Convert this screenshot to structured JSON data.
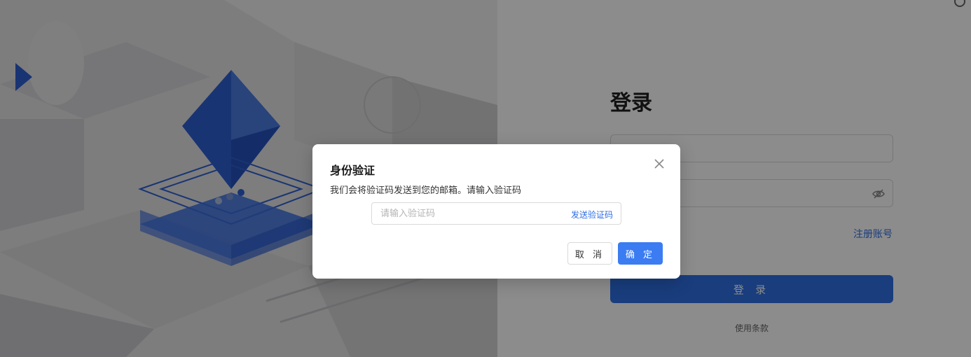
{
  "login": {
    "title": "登录",
    "email_value": "··· ·····",
    "register_link": "注册账号",
    "login_button": "登 录",
    "terms_link": "使用条款"
  },
  "modal": {
    "title": "身份验证",
    "description": "我们会将验证码发送到您的邮箱。请输入验证码",
    "code_placeholder": "请输入验证码",
    "send_code": "发送验证码",
    "cancel": "取 消",
    "confirm": "确 定"
  },
  "colors": {
    "accent": "#2f6fe4",
    "illustration_blue": "#2e5fd1"
  },
  "icons": {
    "eye": "eye-slash-icon",
    "close": "close-icon",
    "logo": "triangle-logo-icon"
  }
}
